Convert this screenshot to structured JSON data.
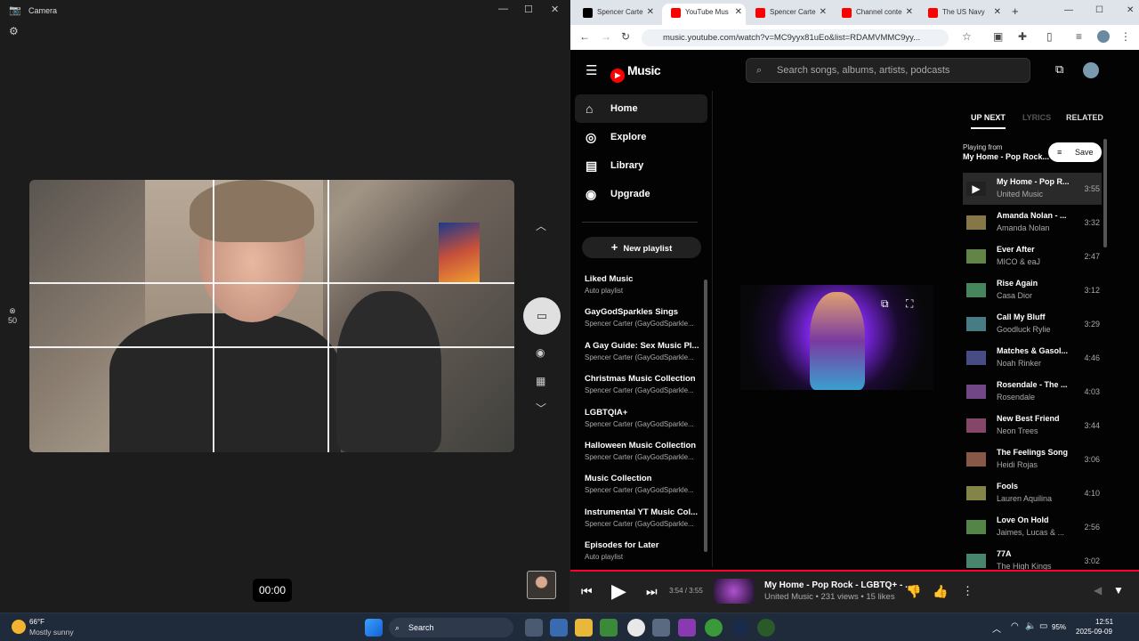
{
  "camera": {
    "title": "Camera",
    "zoom": "50",
    "timer": "00:00"
  },
  "browser": {
    "tabs": [
      {
        "label": "Spencer Carte",
        "color": "#000"
      },
      {
        "label": "YouTube Mus",
        "color": "#f00"
      },
      {
        "label": "Spencer Carte",
        "color": "#f00"
      },
      {
        "label": "Channel conte",
        "color": "#f00"
      },
      {
        "label": "The US Navy",
        "color": "#f00"
      }
    ],
    "url": "music.youtube.com/watch?v=MC9yyx81uEo&list=RDAMVMMC9yy...",
    "zoom": ""
  },
  "ytm": {
    "logo": "Music",
    "search_placeholder": "Search songs, albums, artists, podcasts",
    "nav": [
      {
        "label": "Home",
        "icon": "⌂"
      },
      {
        "label": "Explore",
        "icon": "◎"
      },
      {
        "label": "Library",
        "icon": "▤"
      },
      {
        "label": "Upgrade",
        "icon": "◉"
      }
    ],
    "new_playlist": "New playlist",
    "playlists": [
      {
        "title": "Liked Music",
        "sub": "Auto playlist"
      },
      {
        "title": "GayGodSparkles Sings",
        "sub": "Spencer Carter (GayGodSparkle..."
      },
      {
        "title": "A Gay Guide: Sex Music Pl...",
        "sub": "Spencer Carter (GayGodSparkle..."
      },
      {
        "title": "Christmas Music Collection",
        "sub": "Spencer Carter (GayGodSparkle..."
      },
      {
        "title": "LGBTQIA+",
        "sub": "Spencer Carter (GayGodSparkle..."
      },
      {
        "title": "Halloween Music Collection",
        "sub": "Spencer Carter (GayGodSparkle..."
      },
      {
        "title": "Music Collection",
        "sub": "Spencer Carter (GayGodSparkle..."
      },
      {
        "title": "Instrumental YT Music Col...",
        "sub": "Spencer Carter (GayGodSparkle..."
      },
      {
        "title": "Episodes for Later",
        "sub": "Auto playlist"
      }
    ],
    "queue_tabs": {
      "upnext": "UP NEXT",
      "lyrics": "LYRICS",
      "related": "RELATED"
    },
    "playing_from_label": "Playing from",
    "playing_from": "My Home - Pop Rock...",
    "save": "Save",
    "queue": [
      {
        "t": "My Home - Pop R...",
        "a": "United Music",
        "d": "3:55"
      },
      {
        "t": "Amanda Nolan - ...",
        "a": "Amanda Nolan",
        "d": "3:32"
      },
      {
        "t": "Ever After",
        "a": "MICO & eaJ",
        "d": "2:47"
      },
      {
        "t": "Rise Again",
        "a": "Casa Dior",
        "d": "3:12"
      },
      {
        "t": "Call My Bluff",
        "a": "Goodluck Rylie",
        "d": "3:29"
      },
      {
        "t": "Matches & Gasol...",
        "a": "Noah Rinker",
        "d": "4:46"
      },
      {
        "t": "Rosendale - The ...",
        "a": "Rosendale",
        "d": "4:03"
      },
      {
        "t": "New Best Friend",
        "a": "Neon Trees",
        "d": "3:44"
      },
      {
        "t": "The Feelings Song",
        "a": "Heidi Rojas",
        "d": "3:06"
      },
      {
        "t": "Fools",
        "a": "Lauren Aquilina",
        "d": "4:10"
      },
      {
        "t": "Love On Hold",
        "a": "Jaimes, Lucas & ...",
        "d": "2:56"
      },
      {
        "t": "77A",
        "a": "The High Kings",
        "d": "3:02"
      }
    ],
    "player": {
      "time": "3:54 / 3:55",
      "title": "My Home - Pop Rock - LGBTQ+ - ...",
      "meta": "United Music • 231 views • 15 likes"
    }
  },
  "taskbar": {
    "temp": "66°F",
    "weather": "Mostly sunny",
    "search": "Search",
    "battery": "95%",
    "time": "12:51",
    "date": "2025-09-09"
  }
}
